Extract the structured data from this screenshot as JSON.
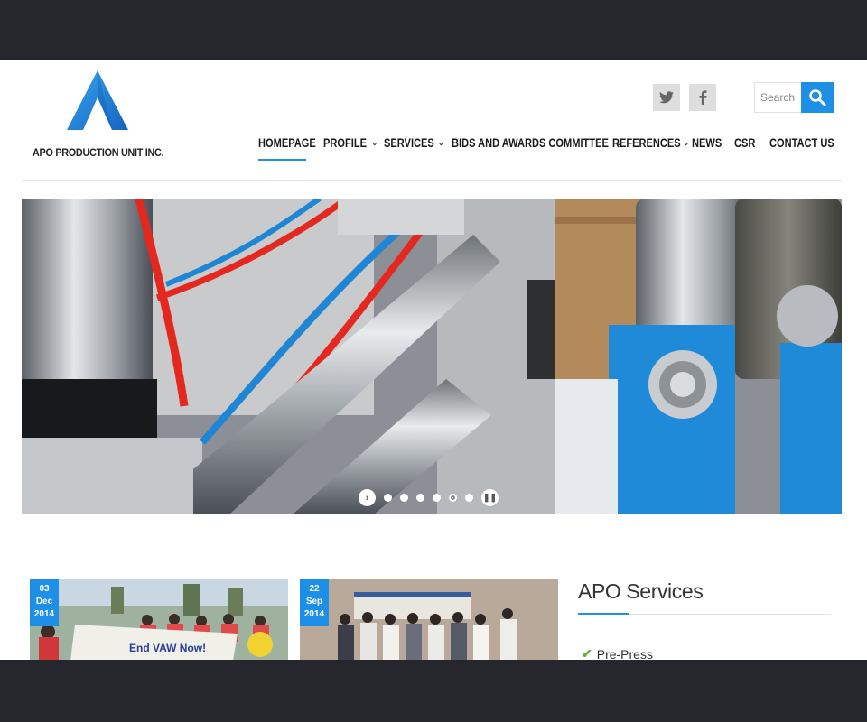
{
  "brand": {
    "name": "APO PRODUCTION UNIT INC.",
    "logo_color": "#1e8fe6"
  },
  "social": [
    {
      "name": "twitter",
      "icon": "twitter-icon"
    },
    {
      "name": "facebook",
      "icon": "facebook-icon"
    }
  ],
  "search": {
    "placeholder": "Search",
    "icon": "search-icon",
    "color": "#1e8fe6"
  },
  "nav": {
    "items": [
      {
        "label": "HOMEPAGE",
        "dropdown": false,
        "active": true
      },
      {
        "label": "PROFILE",
        "dropdown": true
      },
      {
        "label": "SERVICES",
        "dropdown": true
      },
      {
        "label": "BIDS AND AWARDS COMMITTEE",
        "dropdown": true
      },
      {
        "label": "REFERENCES",
        "dropdown": true
      },
      {
        "label": "NEWS",
        "dropdown": false
      },
      {
        "label": "CSR",
        "dropdown": false
      },
      {
        "label": "CONTACT US",
        "dropdown": false
      }
    ]
  },
  "slider": {
    "slide_count": 6,
    "active_slide": 5,
    "next_icon": "chevron-right-icon",
    "pause_icon": "pause-icon"
  },
  "news": [
    {
      "day": "03",
      "month": "Dec",
      "year": "2014"
    },
    {
      "day": "22",
      "month": "Sep",
      "year": "2014"
    }
  ],
  "services": {
    "title": "APO Services",
    "items": [
      {
        "label": "Pre-Press",
        "icon": "check-icon"
      }
    ]
  },
  "colors": {
    "accent": "#1e8fe6",
    "frame_bg": "#25272c",
    "check": "#5bb531"
  }
}
